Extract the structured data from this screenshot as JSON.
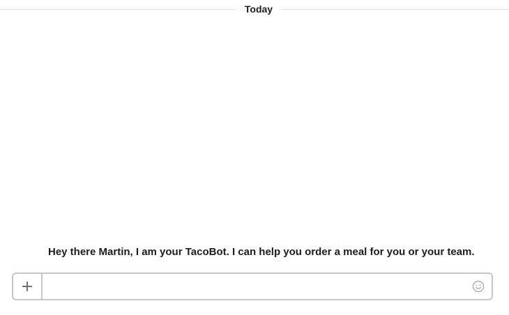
{
  "divider": {
    "label": "Today"
  },
  "message": {
    "text": "Hey there Martin, I am your TacoBot. I can help you order a meal for you or your team."
  },
  "composer": {
    "value": "",
    "placeholder": "",
    "attach_icon": "plus-icon",
    "emoji_icon": "smiley-icon"
  },
  "colors": {
    "text": "#1d1c1d",
    "border": "#c7c7c7",
    "divider_line": "#e1e1e1",
    "icon": "#717274"
  }
}
